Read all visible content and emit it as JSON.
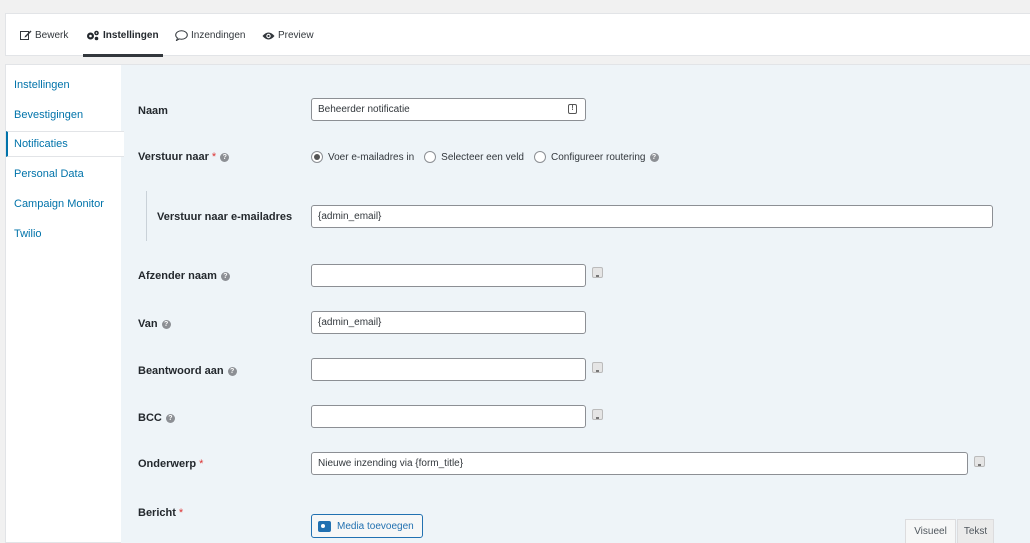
{
  "tabs": [
    {
      "label": "Bewerk",
      "icon": "edit-icon"
    },
    {
      "label": "Instellingen",
      "icon": "gears-icon",
      "active": true
    },
    {
      "label": "Inzendingen",
      "icon": "speech-bubble-icon"
    },
    {
      "label": "Preview",
      "icon": "eye-icon"
    }
  ],
  "sidebar": {
    "items": [
      {
        "label": "Instellingen"
      },
      {
        "label": "Bevestigingen"
      },
      {
        "label": "Notificaties",
        "active": true
      },
      {
        "label": "Personal Data"
      },
      {
        "label": "Campaign Monitor"
      },
      {
        "label": "Twilio"
      }
    ]
  },
  "form": {
    "naam": {
      "label": "Naam",
      "value": "Beheerder notificatie"
    },
    "verstuur_naar": {
      "label": "Verstuur naar",
      "required_mark": "*",
      "options": [
        "Voer e-mailadres in",
        "Selecteer een veld",
        "Configureer routering"
      ],
      "selected": "Voer e-mailadres in"
    },
    "verstuur_email": {
      "label": "Verstuur naar e-mailadres",
      "value": "{admin_email}"
    },
    "afzender_naam": {
      "label": "Afzender naam",
      "value": ""
    },
    "van": {
      "label": "Van",
      "value": "{admin_email}"
    },
    "beantwoord_aan": {
      "label": "Beantwoord aan",
      "value": ""
    },
    "bcc": {
      "label": "BCC",
      "value": ""
    },
    "onderwerp": {
      "label": "Onderwerp",
      "required_mark": "*",
      "value": "Nieuwe inzending via {form_title}"
    },
    "bericht": {
      "label": "Bericht",
      "required_mark": "*"
    }
  },
  "editor": {
    "media_button": "Media toevoegen",
    "tab_visual": "Visueel",
    "tab_text": "Tekst"
  },
  "colors": {
    "accent": "#0073aa",
    "required": "#dc3232",
    "content_bg": "#eef4f8"
  }
}
